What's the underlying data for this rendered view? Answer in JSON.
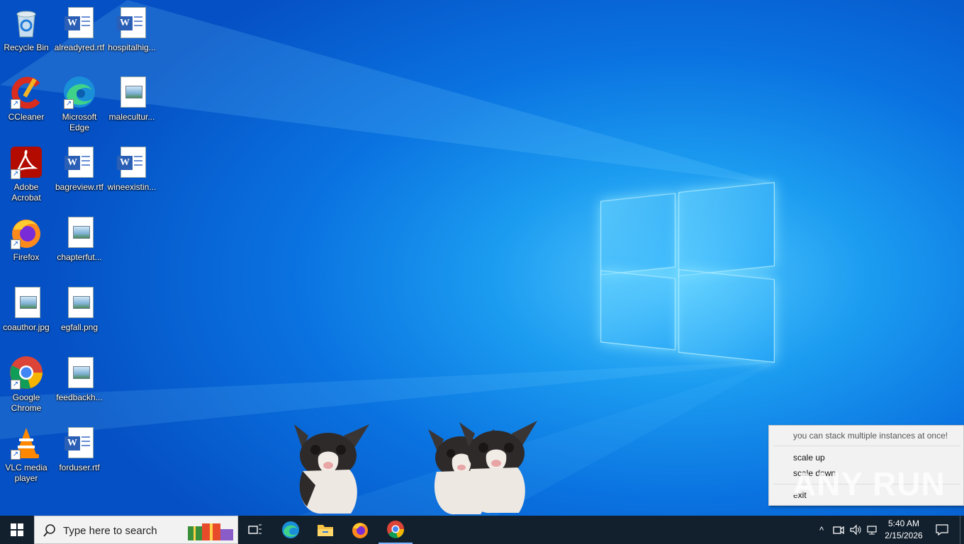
{
  "desktop": {
    "icons": [
      {
        "label": "Recycle Bin",
        "icon": "recycle-bin-icon"
      },
      {
        "label": "alreadyred.rtf",
        "icon": "word-document-icon"
      },
      {
        "label": "hospitalhig...",
        "icon": "word-document-icon"
      },
      {
        "label": "CCleaner",
        "icon": "ccleaner-icon"
      },
      {
        "label": "Microsoft Edge",
        "icon": "edge-icon"
      },
      {
        "label": "malecultur...",
        "icon": "image-file-icon"
      },
      {
        "label": "Adobe Acrobat",
        "icon": "acrobat-icon"
      },
      {
        "label": "bagreview.rtf",
        "icon": "word-document-icon"
      },
      {
        "label": "wineexistin...",
        "icon": "word-document-icon"
      },
      {
        "label": "Firefox",
        "icon": "firefox-icon"
      },
      {
        "label": "chapterfut...",
        "icon": "image-file-icon"
      },
      {
        "label": "coauthor.jpg",
        "icon": "image-file-icon"
      },
      {
        "label": "egfall.png",
        "icon": "image-file-icon"
      },
      {
        "label": "Google Chrome",
        "icon": "chrome-icon"
      },
      {
        "label": "feedbackh...",
        "icon": "image-file-icon"
      },
      {
        "label": "VLC media player",
        "icon": "vlc-icon"
      },
      {
        "label": "forduser.rtf",
        "icon": "word-document-icon"
      }
    ]
  },
  "context_menu": {
    "header": "you can stack multiple instances at once!",
    "items": [
      "scale up",
      "scale down",
      "exit"
    ]
  },
  "taskbar": {
    "search_placeholder": "Type here to search",
    "apps": [
      "task-view-icon",
      "edge-icon",
      "file-explorer-icon",
      "firefox-icon",
      "chrome-icon"
    ],
    "clock_time": "5:40 AM",
    "clock_date": "2/15/2026"
  },
  "watermark": "ANY RUN",
  "colors": {
    "taskbar": "#12202e",
    "accent": "#0a73e0"
  }
}
